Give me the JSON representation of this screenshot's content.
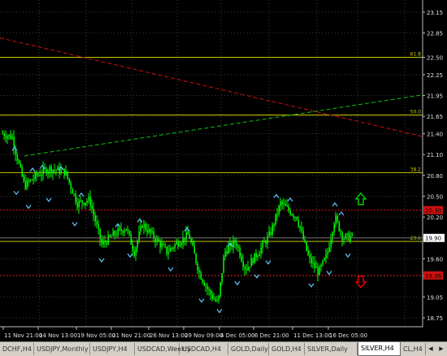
{
  "chart": {
    "price_labels": [
      "23.15",
      "22.85",
      "22.50",
      "22.25",
      "21.95",
      "21.65",
      "21.40",
      "21.10",
      "20.80",
      "20.50",
      "20.20",
      "19.90",
      "19.60",
      "19.35",
      "19.05",
      "18.75"
    ],
    "time_labels": [
      "11 Nov 21:00",
      "14 Nov 13:00",
      "19 Nov 05:00",
      "21 Nov 21:00",
      "26 Nov 13:00",
      "29 Nov 09:00",
      "4 Dec 05:00",
      "6 Dec 21:00",
      "11 Dec 13:00",
      "16 Dec 05:00"
    ],
    "fib_levels": [
      {
        "label": "61.8",
        "value": 22.5
      },
      {
        "label": "50.0",
        "value": 21.67
      },
      {
        "label": "38.2",
        "value": 20.84
      },
      {
        "label": "23.6",
        "value": 19.85
      }
    ],
    "markers": [
      {
        "label": "20.30",
        "value": 20.3
      },
      {
        "label": "19.36",
        "value": 19.36
      }
    ],
    "current_price": "19.90",
    "colors": {
      "candle": "#00ff00",
      "fractal": "#5fc8ff",
      "fib": "#c8c800",
      "trend_down": "#d01010",
      "trend_up": "#10c010",
      "marker": "#d01010",
      "price_box": "#ffffff",
      "arrow_up": "#00cc00",
      "arrow_down": "#e00000"
    },
    "icons": {
      "up": "arrow-up-icon",
      "down": "arrow-down-icon"
    }
  },
  "tabs": [
    "DCHF,H4",
    "USDJPY,Monthly",
    "USDJPY,H4",
    "USDCAD,Weekly",
    "USDCAD,H4",
    "GOLD,Daily",
    "GOLD,H4",
    "SILVER,Daily",
    "SILVER,H4",
    "CL,H4"
  ],
  "active_tab": "SILVER,H4"
}
